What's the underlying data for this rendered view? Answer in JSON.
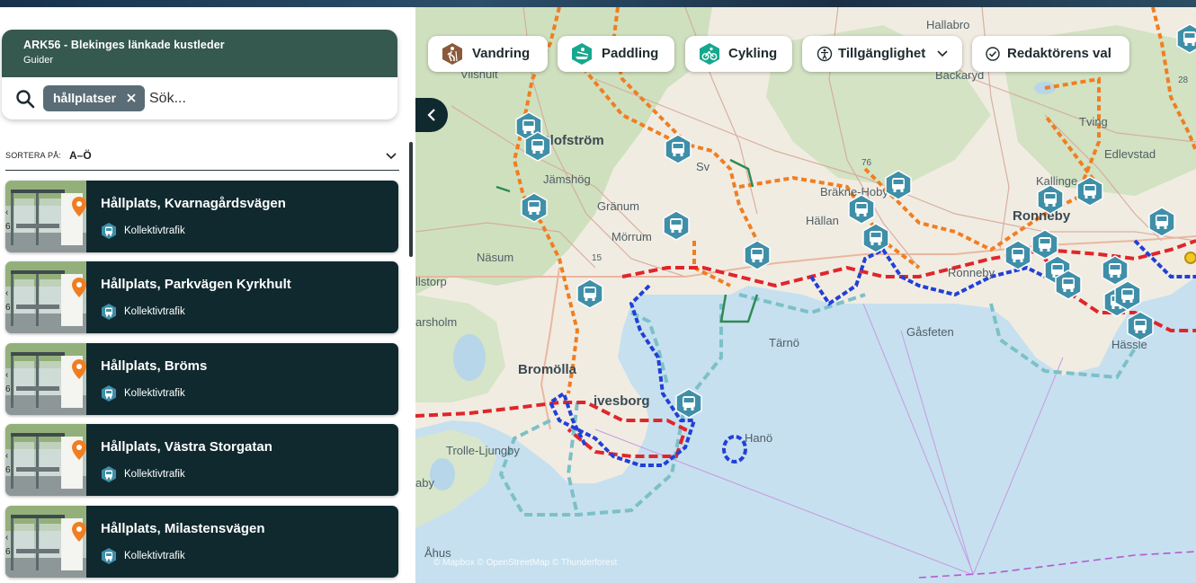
{
  "sidebar": {
    "search": {
      "title": "ARK56 - Blekinges länkade kustleder",
      "subtitle": "Guider",
      "chip": "hållplatser",
      "placeholder": "Sök..."
    },
    "sort": {
      "label": "SORTERA PÅ:",
      "value": "A–Ö"
    },
    "results": [
      {
        "title": "Hållplats, Kvarnagårdsvägen",
        "category": "Kollektivtrafik"
      },
      {
        "title": "Hållplats, Parkvägen Kyrkhult",
        "category": "Kollektivtrafik"
      },
      {
        "title": "Hållplats, Bröms",
        "category": "Kollektivtrafik"
      },
      {
        "title": "Hållplats, Västra Storgatan",
        "category": "Kollektivtrafik"
      },
      {
        "title": "Hållplats, Milastensvägen",
        "category": "Kollektivtrafik"
      }
    ]
  },
  "filters": [
    {
      "label": "Vandring",
      "icon": "hiking-icon"
    },
    {
      "label": "Paddling",
      "icon": "paddling-icon"
    },
    {
      "label": "Cykling",
      "icon": "cycling-icon"
    },
    {
      "label": "Tillgänglighet",
      "icon": "accessibility-icon"
    },
    {
      "label": "Redaktörens val",
      "icon": "check-circle-icon"
    }
  ],
  "map": {
    "place_labels": {
      "vilshult": "Vilshult",
      "hallabro": "Hallabro",
      "backaryd": "Backaryd",
      "olofstrom": "Olofström",
      "jamshog": "Jämshög",
      "granum": "Gränum",
      "morrum": "Mörrum",
      "nasum": "Näsum",
      "ronneby": "Ronneby",
      "kallinge": "Kallinge",
      "tving": "Tving",
      "edlevstad": "Edlevstad",
      "gasfeten": "Gåsfeten",
      "tarno": "Tärnö",
      "bromolla": "Bromölla",
      "hano": "Hanö",
      "trolle_ljungby": "Trolle-Ljungby",
      "ahus": "Åhus",
      "harsholm": "arsholm",
      "lstorp": "llstorp",
      "ivesborg": "ivesborg",
      "aby": "aby",
      "hassle": "Hässle",
      "hallan": "Hällan",
      "svangsta": "Sv",
      "ronnebyvik": "Ronneby",
      "bakne_holja": "Bräkne-Hoby",
      "nasum_n": "Näsum"
    },
    "road_numbers": {
      "r76": "76",
      "r15": "15",
      "r28": "28"
    },
    "attribution": "© Mapbox © OpenStreetMap © Thunderforest",
    "colors": {
      "water": "#c6e0ef",
      "land": "#f1ece2",
      "forest": "#cfe0bf",
      "hiking": "#f07e21",
      "paddling": "#2140d6",
      "cycling": "#e0262b",
      "coastline": "#7cc0c8",
      "bus_marker": "#3f8fa8"
    }
  }
}
